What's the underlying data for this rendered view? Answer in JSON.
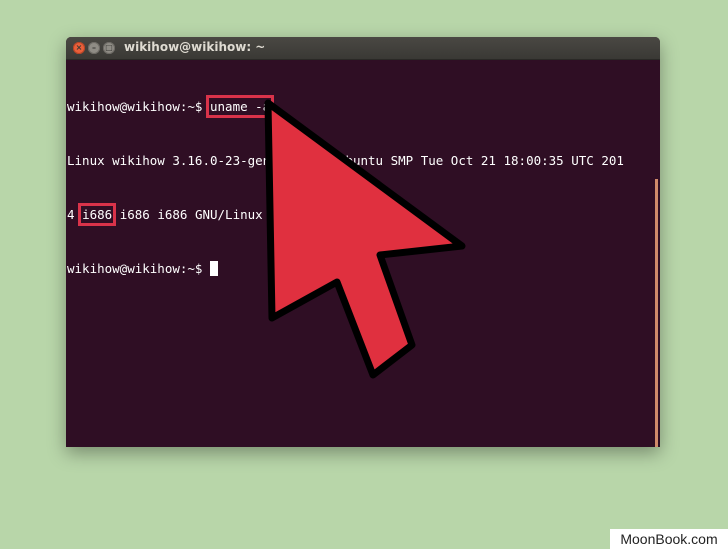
{
  "window": {
    "title": "wikihow@wikihow: ~",
    "buttons": {
      "close": "×",
      "minimize": "–",
      "maximize": "□"
    }
  },
  "terminal": {
    "line1_prompt": "wikihow@wikihow:~$ ",
    "line1_command": "uname -a",
    "line2": "Linux wikihow 3.16.0-23-generic #31-Ubuntu SMP Tue Oct 21 18:00:35 UTC 201",
    "line3_prefix": "4 ",
    "line3_highlight": "i686",
    "line3_rest": " i686 i686 GNU/Linux",
    "line4_prompt": "wikihow@wikihow:~$ "
  },
  "colors": {
    "background": "#b8d6a9",
    "terminal": "#2f0e24",
    "highlight": "#d9334a",
    "arrow": "#e0303f"
  },
  "watermark": "MoonBook.com"
}
